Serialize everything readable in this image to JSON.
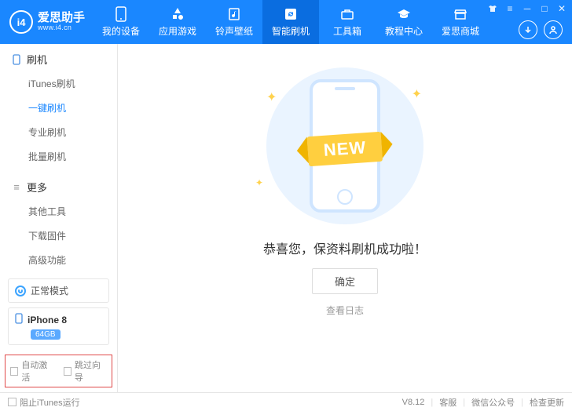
{
  "brand": {
    "title": "爱思助手",
    "subtitle": "www.i4.cn",
    "logo_text": "i4"
  },
  "nav": {
    "items": [
      {
        "label": "我的设备"
      },
      {
        "label": "应用游戏"
      },
      {
        "label": "铃声壁纸"
      },
      {
        "label": "智能刷机"
      },
      {
        "label": "工具箱"
      },
      {
        "label": "教程中心"
      },
      {
        "label": "爱思商城"
      }
    ],
    "active_index": 3
  },
  "sidebar": {
    "group1": {
      "title": "刷机",
      "items": [
        "iTunes刷机",
        "一键刷机",
        "专业刷机",
        "批量刷机"
      ],
      "active_index": 1
    },
    "group2": {
      "title": "更多",
      "items": [
        "其他工具",
        "下载固件",
        "高级功能"
      ]
    },
    "mode": "正常模式",
    "device": {
      "name": "iPhone 8",
      "storage": "64GB"
    },
    "options": {
      "auto_activate": "自动激活",
      "skip_guide": "跳过向导"
    }
  },
  "main": {
    "ribbon": "NEW",
    "success_msg": "恭喜您，保资料刷机成功啦！",
    "ok_label": "确定",
    "view_log": "查看日志"
  },
  "statusbar": {
    "block_itunes": "阻止iTunes运行",
    "version": "V8.12",
    "links": [
      "客服",
      "微信公众号",
      "检查更新"
    ]
  }
}
